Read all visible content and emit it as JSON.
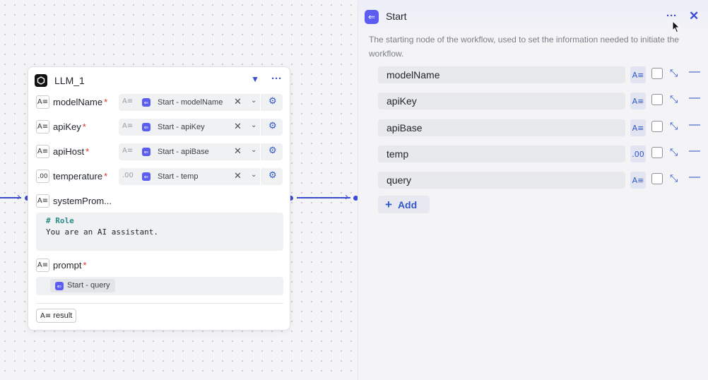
{
  "node": {
    "title": "LLM_1",
    "logo_icon": "llm-logo-icon",
    "params": [
      {
        "label": "modelName",
        "required": "*",
        "type_icon": "A≡",
        "ref": "Start - modelName"
      },
      {
        "label": "apiKey",
        "required": "*",
        "type_icon": "A≡",
        "ref": "Start - apiKey"
      },
      {
        "label": "apiHost",
        "required": "*",
        "type_icon": "A≡",
        "ref": "Start - apiBase"
      },
      {
        "label": "temperature",
        "required": "*",
        "type_icon": ".00",
        "ref": "Start - temp"
      }
    ],
    "system_prompt": {
      "label": "systemProm...",
      "type_icon": "A≡",
      "line1": "# Role",
      "line2": "You are an AI assistant."
    },
    "prompt": {
      "label": "prompt",
      "required": "*",
      "type_icon": "A≡",
      "ref": "Start - query"
    },
    "output": {
      "type_icon": "A≡",
      "label": "result"
    }
  },
  "panel": {
    "title": "Start",
    "description": "The starting node of the workflow, used to set the information needed to initiate the workflow.",
    "variables": [
      {
        "name": "modelName",
        "type_icon": "A≡"
      },
      {
        "name": "apiKey",
        "type_icon": "A≡"
      },
      {
        "name": "apiBase",
        "type_icon": "A≡"
      },
      {
        "name": "temp",
        "type_icon": ".00"
      },
      {
        "name": "query",
        "type_icon": "A≡"
      }
    ],
    "add_label": "Add"
  },
  "colors": {
    "accent": "#3a4ad1",
    "ref_icon": "#5b5cf0",
    "required": "#d93026"
  }
}
